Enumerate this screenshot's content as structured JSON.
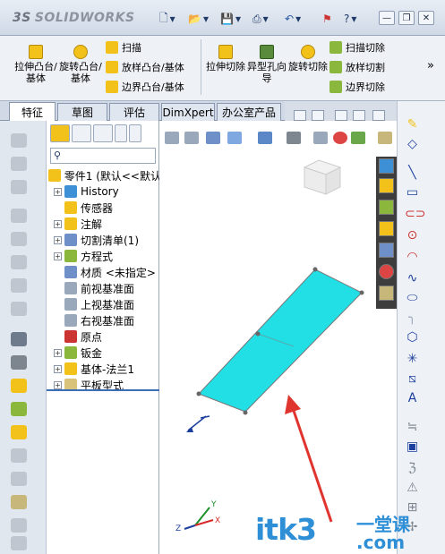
{
  "app": {
    "logo_text": "SOLIDWORKS",
    "logo_prefix": "3S"
  },
  "titlebar": {
    "new": "▾",
    "open": "▾",
    "save": "▾",
    "print": "▾",
    "undo": "▾",
    "help": "?",
    "help_arrow": "▾",
    "minimize": "—",
    "restore": "❐",
    "close": "✕"
  },
  "commands": {
    "extrude_boss": "拉伸凸台/基体",
    "revolve_boss": "旋转凸台/基体",
    "sweep": "扫描",
    "loft_boss": "放样凸台/基体",
    "boundary_boss": "边界凸台/基体",
    "extrude_cut": "拉伸切除",
    "hole_wizard": "异型孔向导",
    "revolve_cut": "旋转切除",
    "swept_cut": "扫描切除",
    "lofted_cut": "放样切割",
    "boundary_cut": "边界切除",
    "more": "»"
  },
  "tabs": [
    "特征",
    "草图",
    "评估",
    "DimXpert",
    "办公室产品"
  ],
  "tree": {
    "root": "零件1 (默认<<默认",
    "items": [
      {
        "label": "History",
        "expand": true
      },
      {
        "label": "传感器",
        "expand": false
      },
      {
        "label": "注解",
        "expand": true
      },
      {
        "label": "切割清单(1)",
        "expand": true
      },
      {
        "label": "方程式",
        "expand": true
      },
      {
        "label": "材质 <未指定>",
        "expand": false
      },
      {
        "label": "前视基准面",
        "expand": false
      },
      {
        "label": "上视基准面",
        "expand": false
      },
      {
        "label": "右视基准面",
        "expand": false
      },
      {
        "label": "原点",
        "expand": false
      },
      {
        "label": "钣金",
        "expand": true
      },
      {
        "label": "基体-法兰1",
        "expand": true
      },
      {
        "label": "平板型式",
        "expand": true
      }
    ]
  },
  "viewport": {
    "triad_x": "X",
    "triad_y": "Y",
    "triad_z": "Z"
  },
  "watermark": {
    "main": "itk3",
    "dot": ".com",
    "cn": "一堂课"
  },
  "colors": {
    "part": "#22dfe6",
    "arrow": "#e0342f",
    "accent": "#2f8fd6"
  }
}
